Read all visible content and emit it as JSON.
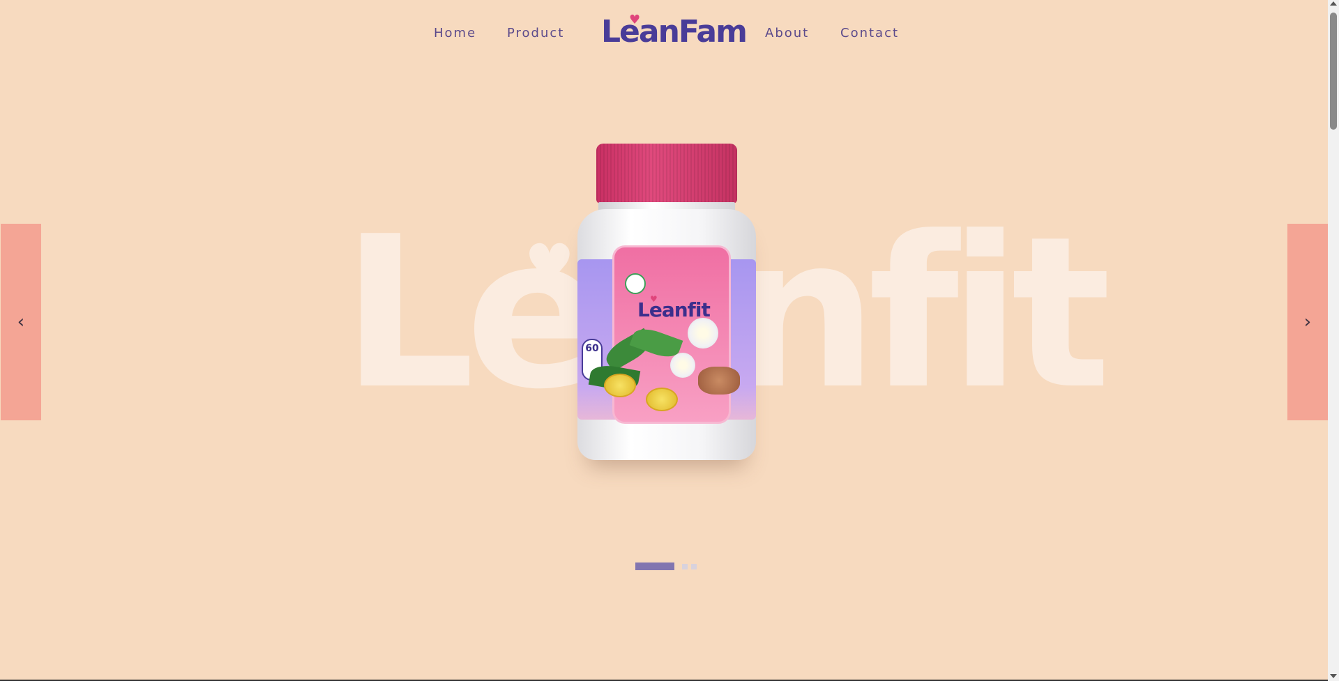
{
  "nav": {
    "links": [
      "Home",
      "Product",
      "About",
      "Contact"
    ],
    "logo": "LeanFam"
  },
  "hero": {
    "background_word": "Leanfit",
    "product": {
      "brand": "Leanfit",
      "count_badge": "60"
    },
    "prev_icon": "chevron-left-icon",
    "next_icon": "chevron-right-icon",
    "slides": {
      "total": 3,
      "active": 1
    }
  },
  "colors": {
    "background": "#f7dabf",
    "accent": "#493c98",
    "heart": "#e0457b",
    "arrow_bg": "#f4a595",
    "active_dot": "#8275b0"
  }
}
